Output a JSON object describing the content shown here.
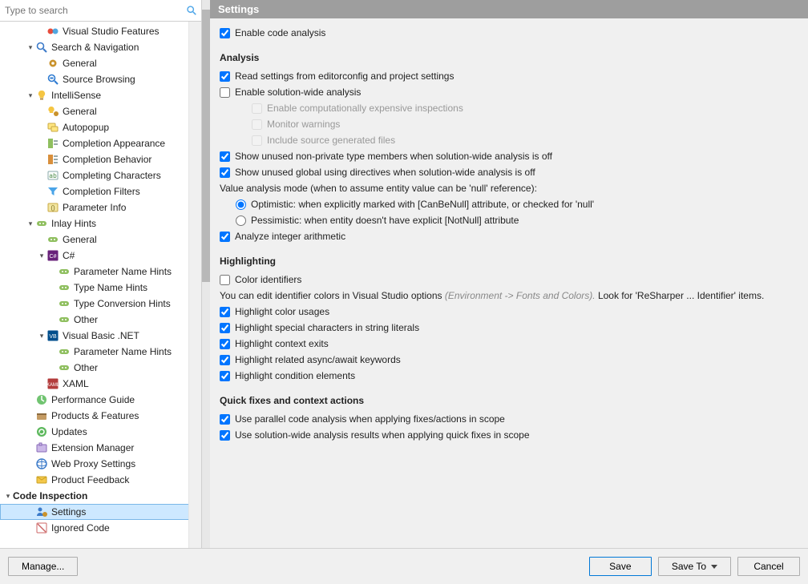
{
  "search": {
    "placeholder": "Type to search"
  },
  "tree": [
    {
      "indent": 3,
      "arrow": "",
      "icon": "vs-features",
      "label": "Visual Studio Features"
    },
    {
      "indent": 2,
      "arrow": "▾",
      "icon": "search",
      "label": "Search & Navigation"
    },
    {
      "indent": 3,
      "arrow": "",
      "icon": "gear",
      "label": "General"
    },
    {
      "indent": 3,
      "arrow": "",
      "icon": "source",
      "label": "Source Browsing"
    },
    {
      "indent": 2,
      "arrow": "▾",
      "icon": "bulb",
      "label": "IntelliSense"
    },
    {
      "indent": 3,
      "arrow": "",
      "icon": "bulb-gear",
      "label": "General"
    },
    {
      "indent": 3,
      "arrow": "",
      "icon": "autopopup",
      "label": "Autopopup"
    },
    {
      "indent": 3,
      "arrow": "",
      "icon": "comp-appear",
      "label": "Completion Appearance"
    },
    {
      "indent": 3,
      "arrow": "",
      "icon": "comp-behave",
      "label": "Completion Behavior"
    },
    {
      "indent": 3,
      "arrow": "",
      "icon": "comp-chars",
      "label": "Completing Characters"
    },
    {
      "indent": 3,
      "arrow": "",
      "icon": "funnel",
      "label": "Completion Filters"
    },
    {
      "indent": 3,
      "arrow": "",
      "icon": "param-info",
      "label": "Parameter Info"
    },
    {
      "indent": 2,
      "arrow": "▾",
      "icon": "inlay",
      "label": "Inlay Hints"
    },
    {
      "indent": 3,
      "arrow": "",
      "icon": "inlay",
      "label": "General"
    },
    {
      "indent": 3,
      "arrow": "▾",
      "icon": "csharp",
      "label": "C#"
    },
    {
      "indent": 4,
      "arrow": "",
      "icon": "inlay",
      "label": "Parameter Name Hints"
    },
    {
      "indent": 4,
      "arrow": "",
      "icon": "inlay",
      "label": "Type Name Hints"
    },
    {
      "indent": 4,
      "arrow": "",
      "icon": "inlay",
      "label": "Type Conversion Hints"
    },
    {
      "indent": 4,
      "arrow": "",
      "icon": "inlay",
      "label": "Other"
    },
    {
      "indent": 3,
      "arrow": "▾",
      "icon": "vb",
      "label": "Visual Basic .NET"
    },
    {
      "indent": 4,
      "arrow": "",
      "icon": "inlay",
      "label": "Parameter Name Hints"
    },
    {
      "indent": 4,
      "arrow": "",
      "icon": "inlay",
      "label": "Other"
    },
    {
      "indent": 3,
      "arrow": "",
      "icon": "xaml",
      "label": "XAML"
    },
    {
      "indent": 2,
      "arrow": "",
      "icon": "perf",
      "label": "Performance Guide"
    },
    {
      "indent": 2,
      "arrow": "",
      "icon": "products",
      "label": "Products & Features"
    },
    {
      "indent": 2,
      "arrow": "",
      "icon": "updates",
      "label": "Updates"
    },
    {
      "indent": 2,
      "arrow": "",
      "icon": "ext-mgr",
      "label": "Extension Manager"
    },
    {
      "indent": 2,
      "arrow": "",
      "icon": "proxy",
      "label": "Web Proxy Settings"
    },
    {
      "indent": 2,
      "arrow": "",
      "icon": "feedback",
      "label": "Product Feedback"
    },
    {
      "indent": 0,
      "arrow": "▾",
      "icon": "",
      "label": "Code Inspection",
      "cat": true
    },
    {
      "indent": 2,
      "arrow": "",
      "icon": "settings-person",
      "label": "Settings",
      "selected": true
    },
    {
      "indent": 2,
      "arrow": "",
      "icon": "ignored",
      "label": "Ignored Code"
    }
  ],
  "content": {
    "title": "Settings",
    "enable_analysis": "Enable code analysis",
    "analysis": {
      "heading": "Analysis",
      "read_editorconfig": "Read settings from editorconfig and project settings",
      "enable_solution_wide": "Enable solution-wide analysis",
      "enable_expensive": "Enable computationally expensive inspections",
      "monitor_warnings": "Monitor warnings",
      "include_source_gen": "Include source generated files",
      "unused_nonprivate": "Show unused non-private type members when solution-wide analysis is off",
      "unused_global": "Show unused global using directives when solution-wide analysis is off",
      "value_mode_label": "Value analysis mode (when to assume entity value can be 'null' reference):",
      "optimistic": "Optimistic: when explicitly marked with [CanBeNull] attribute, or checked for 'null'",
      "pessimistic": "Pessimistic: when entity doesn't have explicit [NotNull] attribute",
      "analyze_integer": "Analyze integer arithmetic"
    },
    "highlighting": {
      "heading": "Highlighting",
      "color_identifiers": "Color identifiers",
      "hint1a": "You can edit identifier colors in Visual Studio options ",
      "hint1b": "(Environment -> Fonts and Colors). ",
      "hint1c": "Look for 'ReSharper ... Identifier' items.",
      "hl_color": "Highlight color usages",
      "hl_special": "Highlight special characters in string literals",
      "hl_context": "Highlight context exits",
      "hl_async": "Highlight related async/await keywords",
      "hl_cond": "Highlight condition elements"
    },
    "quickfix": {
      "heading": "Quick fixes and context actions",
      "parallel": "Use parallel code analysis when applying fixes/actions in scope",
      "swea_results": "Use solution-wide analysis results when applying quick fixes in scope"
    }
  },
  "footer": {
    "manage": "Manage...",
    "save": "Save",
    "save_to": "Save To",
    "cancel": "Cancel"
  }
}
